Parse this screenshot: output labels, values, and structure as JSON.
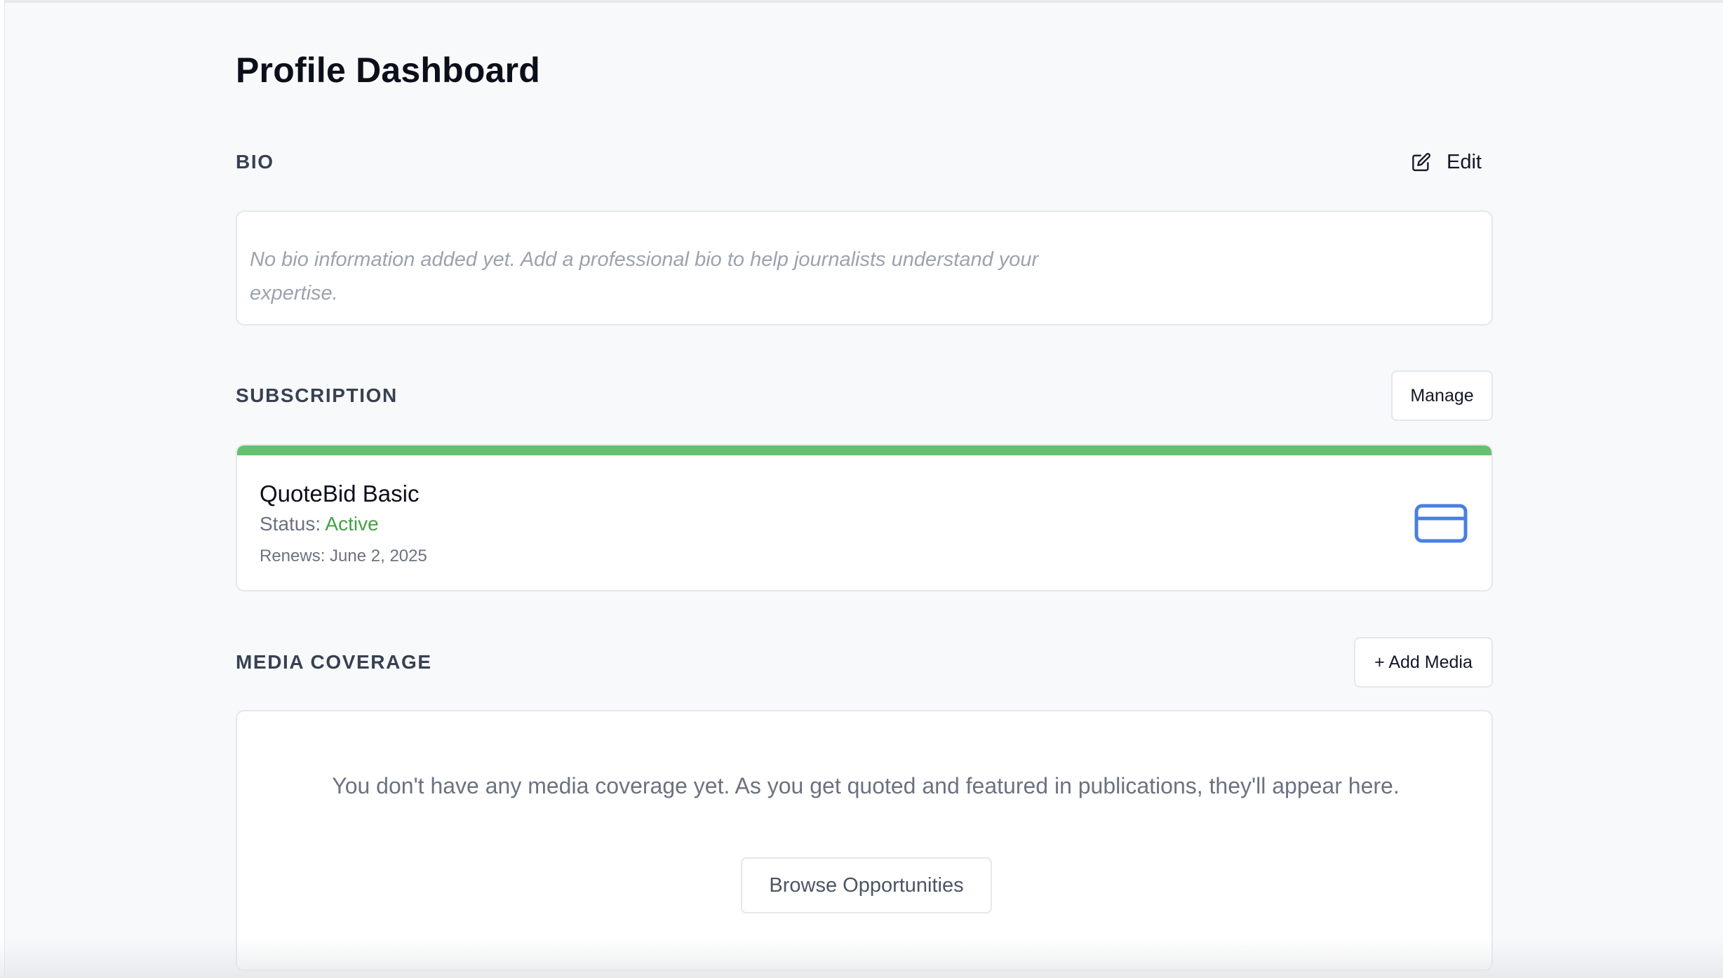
{
  "page": {
    "title": "Profile Dashboard"
  },
  "bio": {
    "heading": "BIO",
    "edit_label": "Edit",
    "empty_text": "No bio information added yet. Add a professional bio to help journalists understand your expertise."
  },
  "subscription": {
    "heading": "SUBSCRIPTION",
    "manage_label": "Manage",
    "plan_name": "QuoteBid Basic",
    "status_label": "Status:",
    "status_value": "Active",
    "renews_text": "Renews: June 2, 2025",
    "accent_color": "#66c06e",
    "status_color": "#43a047",
    "icon": "credit-card-icon"
  },
  "media_coverage": {
    "heading": "MEDIA COVERAGE",
    "add_label": "+ Add Media",
    "empty_text": "You don't have any media coverage yet. As you get quoted and featured in publications, they'll appear here.",
    "browse_label": "Browse Opportunities"
  },
  "colors": {
    "background": "#f8f9fb",
    "icon_blue": "#4a7fe0"
  }
}
